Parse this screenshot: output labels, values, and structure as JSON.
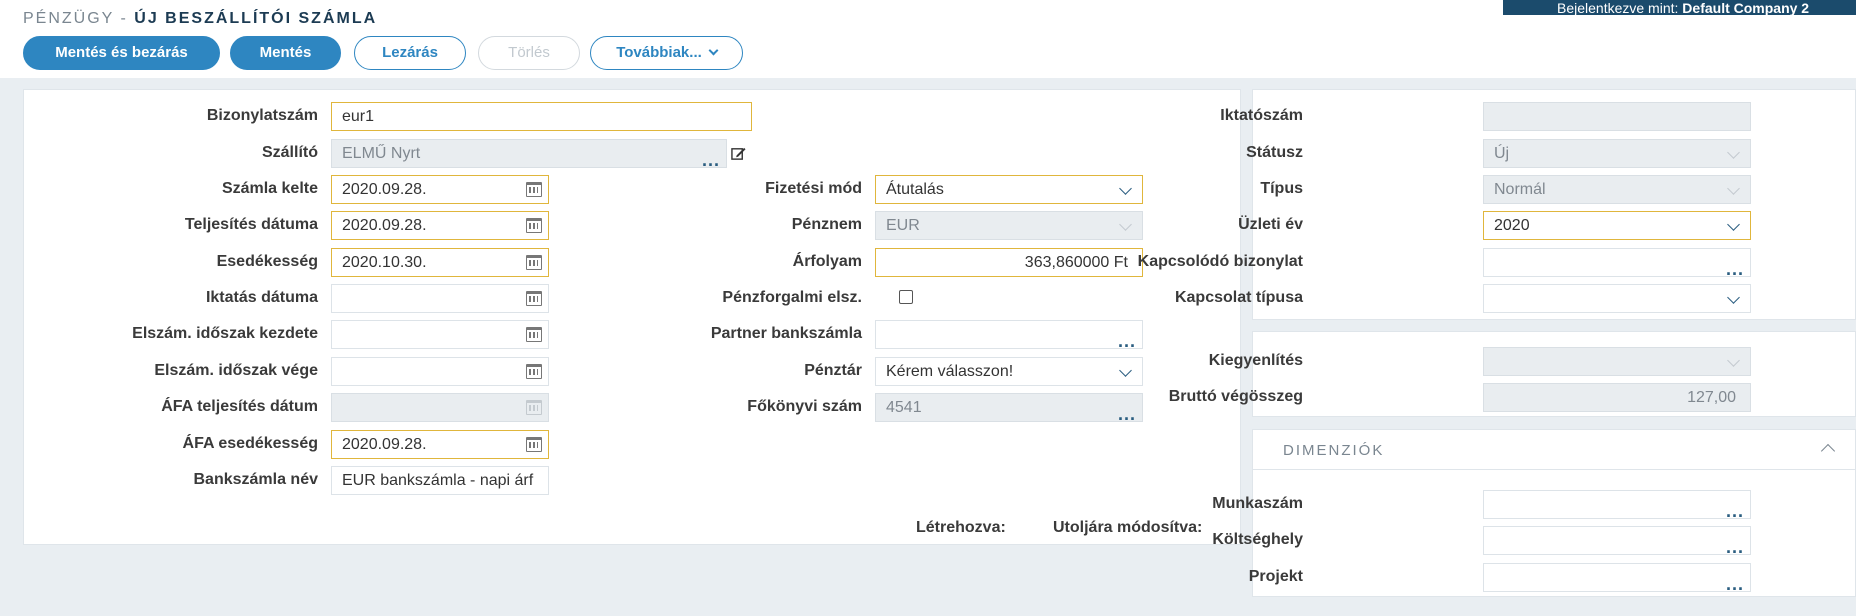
{
  "header": {
    "module": "PÉNZÜGY -",
    "title": "ÚJ BESZÁLLÍTÓI SZÁMLA",
    "login_prefix": "Bejelentkezve mint:",
    "login_company": "Default Company 2"
  },
  "toolbar": {
    "save_close": "Mentés és bezárás",
    "save": "Mentés",
    "close": "Lezárás",
    "delete": "Törlés",
    "more": "Továbbiak..."
  },
  "form": {
    "bizonylatszam": {
      "label": "Bizonylatszám",
      "value": "eur1"
    },
    "szallito": {
      "label": "Szállító",
      "value": "ELMŰ Nyrt"
    },
    "szamla_kelte": {
      "label": "Számla kelte",
      "value": "2020.09.28."
    },
    "teljesites_datuma": {
      "label": "Teljesítés dátuma",
      "value": "2020.09.28."
    },
    "esedekesseg": {
      "label": "Esedékesség",
      "value": "2020.10.30."
    },
    "iktatas_datuma": {
      "label": "Iktatás dátuma",
      "value": ""
    },
    "elszam_kezdete": {
      "label": "Elszám. időszak kezdete",
      "value": ""
    },
    "elszam_vege": {
      "label": "Elszám. időszak vége",
      "value": ""
    },
    "afa_teljesites": {
      "label": "ÁFA teljesítés dátum",
      "value": ""
    },
    "afa_esedekesseg": {
      "label": "ÁFA esedékesség",
      "value": "2020.09.28."
    },
    "bankszamla_nev": {
      "label": "Bankszámla név",
      "value": "EUR bankszámla - napi árf"
    },
    "fizetesi_mod": {
      "label": "Fizetési mód",
      "value": "Átutalás"
    },
    "penznem": {
      "label": "Pénznem",
      "value": "EUR"
    },
    "arfolyam": {
      "label": "Árfolyam",
      "value": "363,860000 Ft"
    },
    "penzforgalmi": {
      "label": "Pénzforgalmi elsz.",
      "checked": false
    },
    "partner_bankszamla": {
      "label": "Partner bankszámla",
      "value": ""
    },
    "penztar": {
      "label": "Pénztár",
      "value": "Kérem válasszon!"
    },
    "fokonyvi_szam": {
      "label": "Főkönyvi szám",
      "value": "4541"
    },
    "letrehozva": "Létrehozva:",
    "utoljara_modositva": "Utoljára módosítva:"
  },
  "side": {
    "iktatoszam": {
      "label": "Iktatószám",
      "value": ""
    },
    "statusz": {
      "label": "Státusz",
      "value": "Új"
    },
    "tipus": {
      "label": "Típus",
      "value": "Normál"
    },
    "uzleti_ev": {
      "label": "Üzleti év",
      "value": "2020"
    },
    "kapcsolodo": {
      "label": "Kapcsolódó bizonylat",
      "value": ""
    },
    "kapcsolat_tipusa": {
      "label": "Kapcsolat típusa",
      "value": ""
    },
    "kiegyenlites": {
      "label": "Kiegyenlítés",
      "value": ""
    },
    "brutto": {
      "label": "Bruttó végösszeg",
      "value": "127,00"
    }
  },
  "dimensions": {
    "title": "DIMENZIÓK",
    "munkaszam": {
      "label": "Munkaszám",
      "value": ""
    },
    "koltseghely": {
      "label": "Költséghely",
      "value": ""
    },
    "projekt": {
      "label": "Projekt",
      "value": ""
    }
  },
  "colors": {
    "primary": "#2e86c1",
    "required_border": "#e0b63c",
    "login_bar": "#1b4b6c"
  }
}
